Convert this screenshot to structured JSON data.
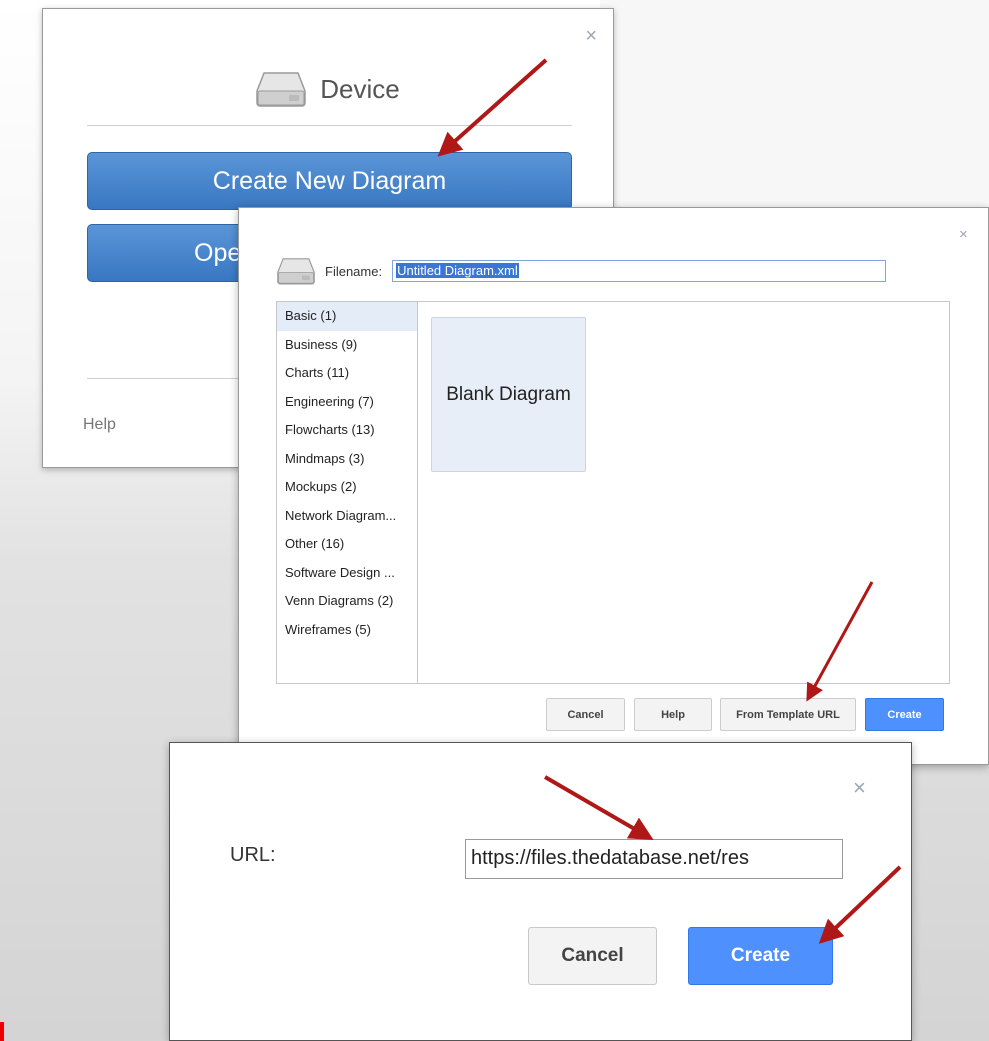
{
  "device_dialog": {
    "close_icon": "×",
    "title": "Device",
    "create_new_label": "Create New Diagram",
    "open_label": "Ope",
    "help_label": "Help",
    "icon": "hard-drive-icon"
  },
  "new_diagram_dialog": {
    "close_icon": "×",
    "filename_label": "Filename:",
    "filename_value": "Untitled Diagram.xml",
    "categories": [
      "Basic (1)",
      "Business (9)",
      "Charts (11)",
      "Engineering (7)",
      "Flowcharts (13)",
      "Mindmaps (3)",
      "Mockups (2)",
      "Network Diagram...",
      "Other (16)",
      "Software Design ...",
      "Venn Diagrams (2)",
      "Wireframes (5)"
    ],
    "selected_category": "Basic (1)",
    "template_label": "Blank Diagram",
    "buttons": {
      "cancel": "Cancel",
      "help": "Help",
      "from_template_url": "From Template URL",
      "create": "Create"
    }
  },
  "url_dialog": {
    "close_icon": "×",
    "url_label": "URL:",
    "url_value": "https://files.thedatabase.net/res",
    "cancel_label": "Cancel",
    "create_label": "Create"
  },
  "colors": {
    "primary_blue": "#4d90fe",
    "device_button_blue": "#4a86cc",
    "arrow_red": "#b01818"
  }
}
